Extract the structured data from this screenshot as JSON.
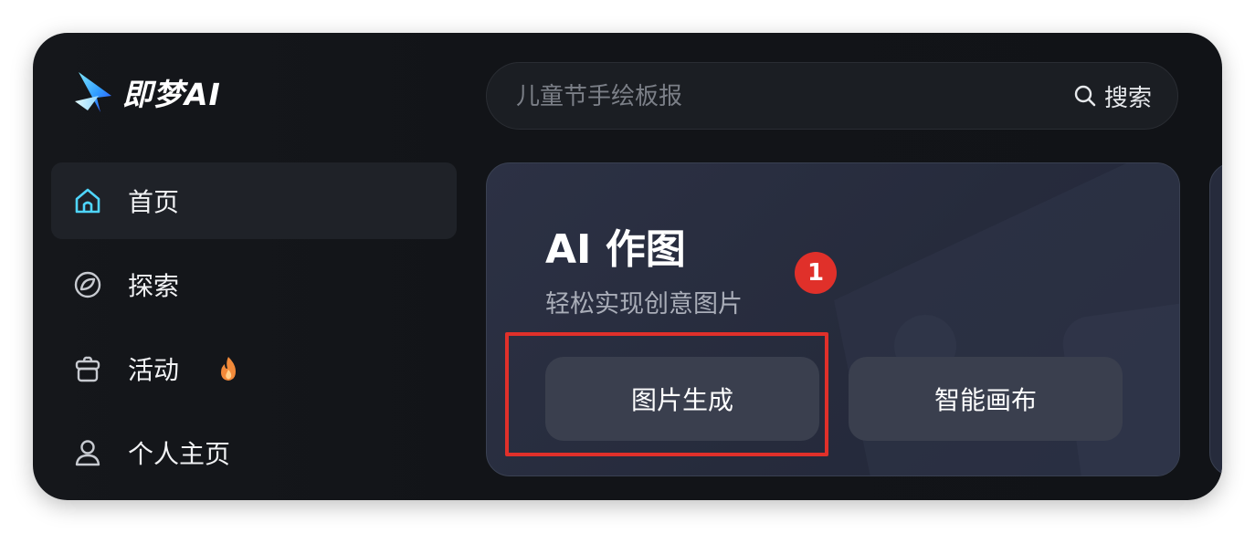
{
  "app": {
    "logo_text": "即梦AI"
  },
  "sidebar": {
    "items": [
      {
        "label": "首页",
        "icon": "home-icon",
        "active": true
      },
      {
        "label": "探索",
        "icon": "explore-icon",
        "active": false
      },
      {
        "label": "活动",
        "icon": "gift-icon",
        "active": false,
        "badge_icon": "fire-icon"
      },
      {
        "label": "个人主页",
        "icon": "user-icon",
        "active": false
      }
    ]
  },
  "search": {
    "placeholder": "儿童节手绘板报",
    "button_label": "搜索",
    "icon": "search-icon"
  },
  "card": {
    "title": "AI 作图",
    "subtitle": "轻松实现创意图片",
    "buttons": [
      "图片生成",
      "智能画布"
    ]
  },
  "annotation": {
    "badge": "1",
    "color": "#e0302a"
  },
  "colors": {
    "background": "#15171b",
    "card": "#2a2f40",
    "button": "#3a3f4e",
    "accent": "#e0302a"
  }
}
